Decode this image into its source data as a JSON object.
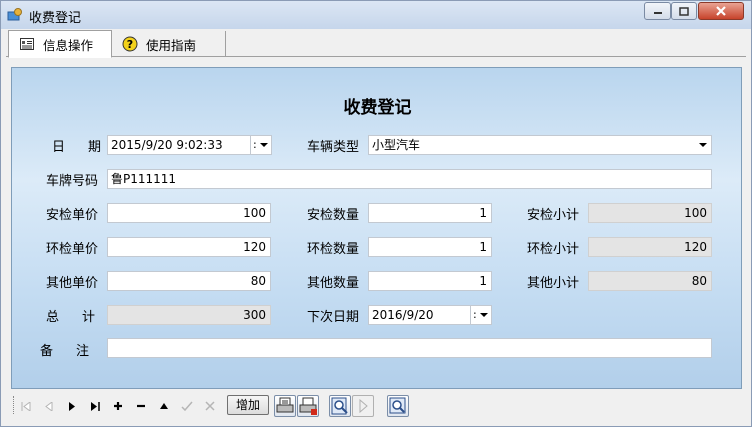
{
  "window": {
    "title": "收费登记"
  },
  "tabs": [
    {
      "label": "信息操作",
      "icon": "form-icon"
    },
    {
      "label": "使用指南",
      "icon": "help-icon"
    }
  ],
  "form": {
    "heading": "收费登记",
    "date_label": "日期",
    "date_value": "2015/9/20 9:02:33",
    "vehicle_type_label": "车辆类型",
    "vehicle_type_value": "小型汽车",
    "plate_label": "车牌号码",
    "plate_value": "鲁P111111",
    "safety_price_label": "安检单价",
    "safety_price_value": "100",
    "safety_qty_label": "安检数量",
    "safety_qty_value": "1",
    "safety_sub_label": "安检小计",
    "safety_sub_value": "100",
    "env_price_label": "环检单价",
    "env_price_value": "120",
    "env_qty_label": "环检数量",
    "env_qty_value": "1",
    "env_sub_label": "环检小计",
    "env_sub_value": "120",
    "other_price_label": "其他单价",
    "other_price_value": "80",
    "other_qty_label": "其他数量",
    "other_qty_value": "1",
    "other_sub_label": "其他小计",
    "other_sub_value": "80",
    "total_label": "总计",
    "total_value": "300",
    "next_date_label": "下次日期",
    "next_date_value": "2016/9/20",
    "remark_label": "备注",
    "remark_value": ""
  },
  "navbar": {
    "add_label": "增加",
    "date_colon": ":"
  },
  "colors": {
    "panel_gradient_top": "#b9d5ee",
    "panel_gradient_mid": "#dcebf8",
    "close_button": "#c7432b"
  }
}
